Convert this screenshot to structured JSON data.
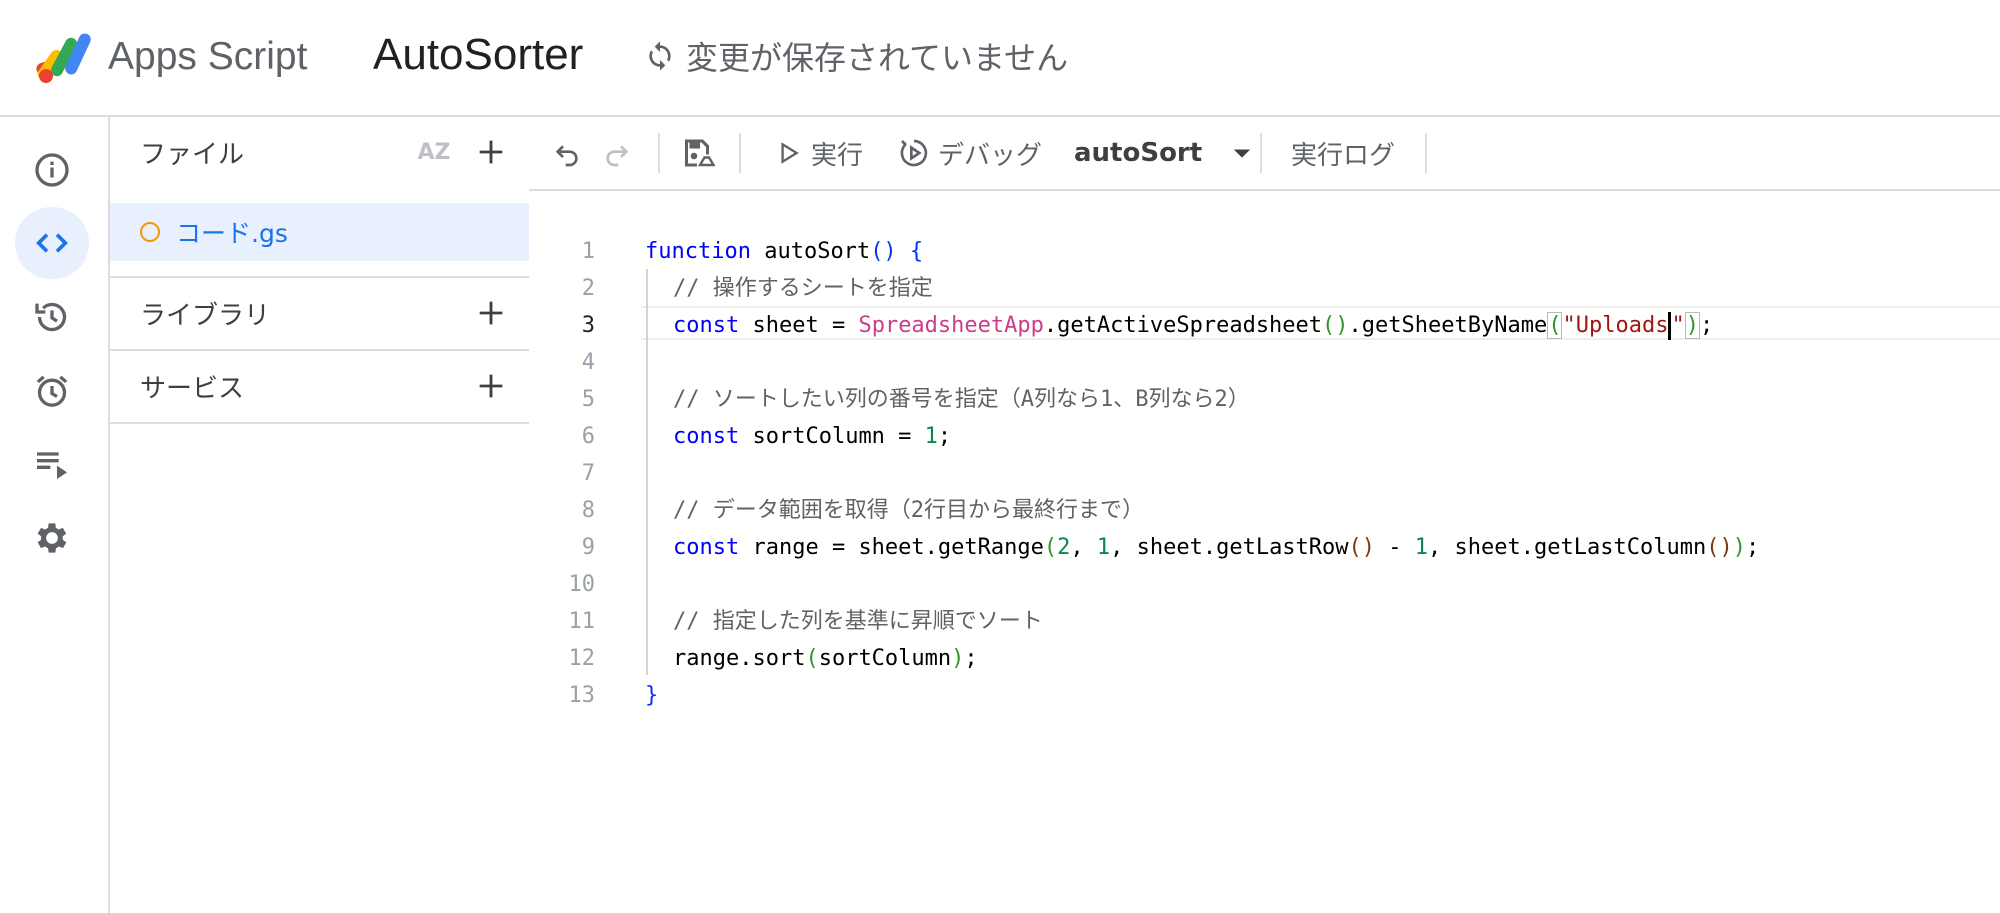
{
  "header": {
    "product_name": "Apps Script",
    "project_name": "AutoSorter",
    "save_status": "変更が保存されていません"
  },
  "rail": {
    "items": [
      {
        "name": "overview",
        "icon": "info-icon"
      },
      {
        "name": "editor",
        "icon": "code-icon",
        "active": true
      },
      {
        "name": "versions",
        "icon": "history-icon"
      },
      {
        "name": "triggers",
        "icon": "alarm-clock-icon"
      },
      {
        "name": "executions",
        "icon": "playlist-play-icon"
      },
      {
        "name": "settings",
        "icon": "gear-icon"
      }
    ]
  },
  "files_panel": {
    "files_label": "ファイル",
    "sort_label": "AZ",
    "files": [
      {
        "name": "コード.gs",
        "selected": true,
        "unsaved_indicator_color": "#f29900"
      }
    ],
    "libraries_label": "ライブラリ",
    "services_label": "サービス"
  },
  "toolbar": {
    "run_label": "実行",
    "debug_label": "デバッグ",
    "function_name": "autoSort",
    "log_label": "実行ログ"
  },
  "editor": {
    "line_numbers": [
      "1",
      "2",
      "3",
      "4",
      "5",
      "6",
      "7",
      "8",
      "9",
      "10",
      "11",
      "12",
      "13"
    ],
    "current_line": 3,
    "lines": {
      "l1": {
        "kw": "function",
        "name": " autoSort",
        "open": "()",
        "brace": " {"
      },
      "l2": {
        "comment": "// 操作するシートを指定"
      },
      "l3": {
        "kw": "const",
        "a": " sheet = ",
        "cls": "SpreadsheetApp",
        "b": ".getActiveSpreadsheet",
        "c": ".getSheetByName",
        "str1": "\"Uploads",
        "str2": "\"",
        "end": ";"
      },
      "l5": {
        "comment": "// ソートしたい列の番号を指定（A列なら1、B列なら2）"
      },
      "l6": {
        "kw": "const",
        "a": " sortColumn = ",
        "num": "1",
        "end": ";"
      },
      "l8": {
        "comment": "// データ範囲を取得（2行目から最終行まで）"
      },
      "l9": {
        "kw": "const",
        "a": " range = sheet.getRange",
        "n1": "2",
        "comma": ", ",
        "n2": "1",
        "b": ", sheet.getLastRow",
        "minus": " - ",
        "n3": "1",
        "c": ", sheet.getLastColumn",
        "end": ";"
      },
      "l11": {
        "comment": "// 指定した列を基準に昇順でソート"
      },
      "l12": {
        "a": "range.sort",
        "arg": "sortColumn",
        "end": ";"
      },
      "l13": {
        "brace": "}"
      }
    }
  },
  "colors": {
    "accent": "#1a73e8",
    "active_bg": "#e8f0fe",
    "keyword": "#0000ff",
    "class": "#cd3c8c",
    "string": "#a31515",
    "number": "#098658"
  }
}
